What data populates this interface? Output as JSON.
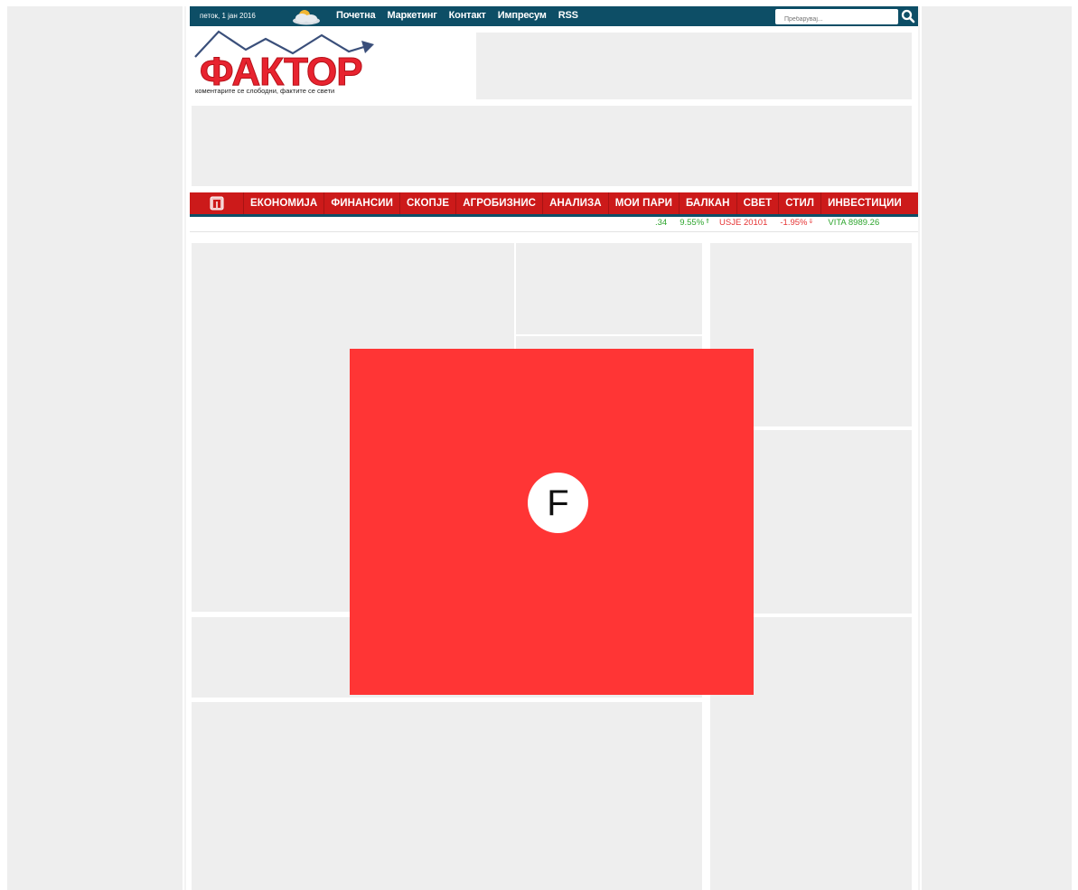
{
  "topbar": {
    "date": "петок, 1 јан 2016",
    "nav": [
      "Почетна",
      "Маркетинг",
      "Контакт",
      "Импресум",
      "RSS"
    ],
    "search_placeholder": "Пребарувај..."
  },
  "logo": {
    "name": "ФАКТОР",
    "tagline": "коментарите се слободни, фактите се свети"
  },
  "main_nav": {
    "home_icon": "home-icon",
    "items": [
      "ЕКОНОМИЈА",
      "ФИНАНСИИ",
      "СКОПЈЕ",
      "АГРОБИЗНИС",
      "АНАЛИЗА",
      "МОИ ПАРИ",
      "БАЛКАН",
      "СВЕТ",
      "СТИЛ",
      "ИНВЕСТИЦИИ"
    ]
  },
  "ticker": [
    {
      "text": ".34",
      "color": "#2ea52e"
    },
    {
      "text": "9.55%",
      "color": "#2ea52e",
      "arrow": "⇑"
    },
    {
      "text": "USJE 20101",
      "color": "#e53333"
    },
    {
      "text": "-1.95%",
      "color": "#e53333",
      "arrow": "⇓"
    },
    {
      "text": "VITA 8989.26",
      "color": "#2ea52e"
    }
  ],
  "modal": {
    "logo_letter": "F",
    "background": "#ff3535"
  },
  "colors": {
    "topbar": "#0d4e66",
    "nav_red": "#cc1a1a",
    "placeholder": "#eeeeee"
  }
}
